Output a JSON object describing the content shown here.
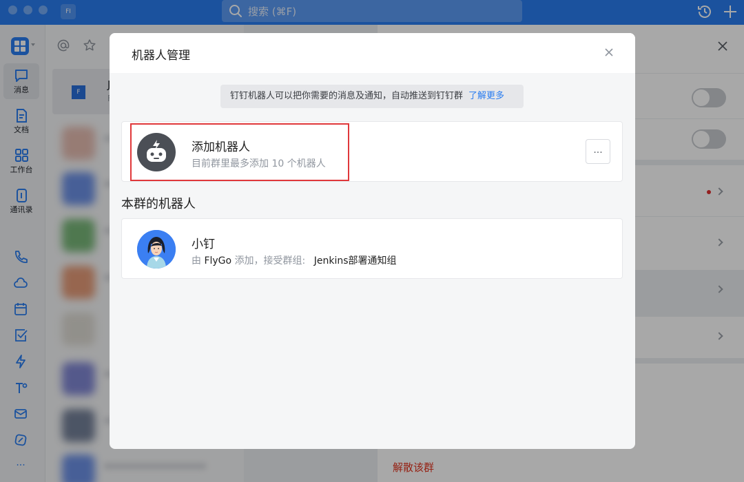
{
  "titlebar": {
    "app_badge": "FI",
    "search_placeholder": "搜索 (⌘F)"
  },
  "nav": {
    "messages_label": "消息",
    "docs_label": "文档",
    "workbench_label": "工作台",
    "contacts_label": "通讯录",
    "more_label": "..."
  },
  "chatlist": {
    "selected_chat_badge": "F",
    "selected_chat_name": "Je",
    "selected_chat_sub": "Fl"
  },
  "settings_panel": {
    "disband_label": "解散该群"
  },
  "modal": {
    "title": "机器人管理",
    "notice_text": "钉钉机器人可以把你需要的消息及通知，自动推送到钉钉群",
    "notice_link": "了解更多",
    "add_robot": {
      "title": "添加机器人",
      "subtitle": "目前群里最多添加 10 个机器人",
      "more_label": "..."
    },
    "section_title": "本群的机器人",
    "robot": {
      "name": "小钉",
      "prefix": "由",
      "added_by": "FlyGo",
      "added_text": "添加，接受群组:",
      "group_name": "Jenkins部署通知组"
    }
  },
  "colors": {
    "brand": "#2a7df0",
    "highlight_border": "#e0373a",
    "danger_text": "#e2321e"
  }
}
